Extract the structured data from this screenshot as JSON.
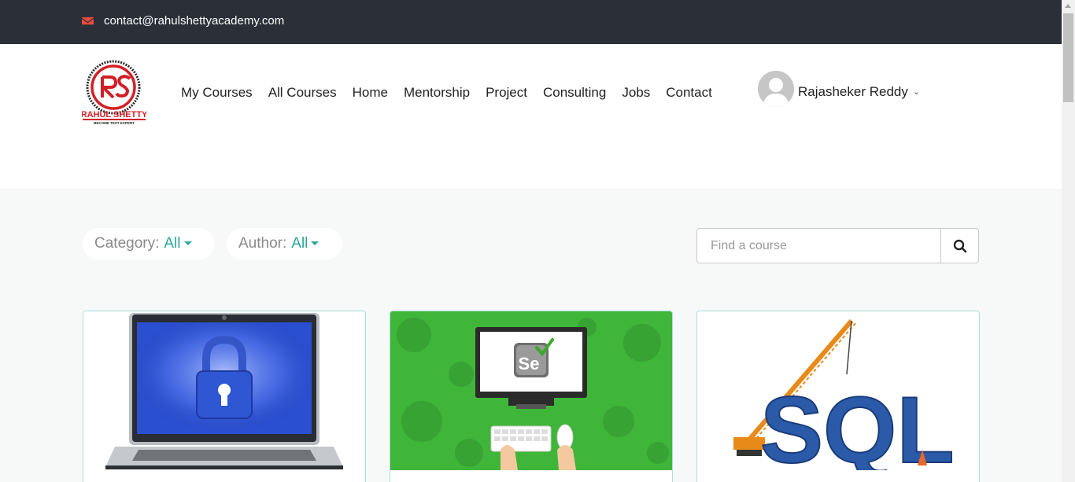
{
  "topbar": {
    "email": "contact@rahulshettyacademy.com",
    "icon": "envelope-icon",
    "icon_color": "#e84c3d"
  },
  "logo": {
    "text": "RAHUL SHETTY",
    "initials": "RS",
    "tagline": "BECOME TEST EXPERT"
  },
  "nav": {
    "items": [
      "My Courses",
      "All Courses",
      "Home",
      "Mentorship",
      "Project",
      "Consulting",
      "Jobs",
      "Contact"
    ]
  },
  "user": {
    "name": "Rajasheker Reddy",
    "avatar": "user-avatar-icon"
  },
  "filters": {
    "category_label": "Category:",
    "category_value": "All",
    "author_label": "Author:",
    "author_value": "All"
  },
  "search": {
    "placeholder": "Find a course",
    "value": ""
  },
  "colors": {
    "accent": "#2ba89b",
    "topbar": "#2a2f38",
    "brand_red": "#d21f26"
  },
  "courses": [
    {
      "image": "laptop-lock-image"
    },
    {
      "image": "selenium-computer-image"
    },
    {
      "image": "sql-crane-image"
    }
  ]
}
